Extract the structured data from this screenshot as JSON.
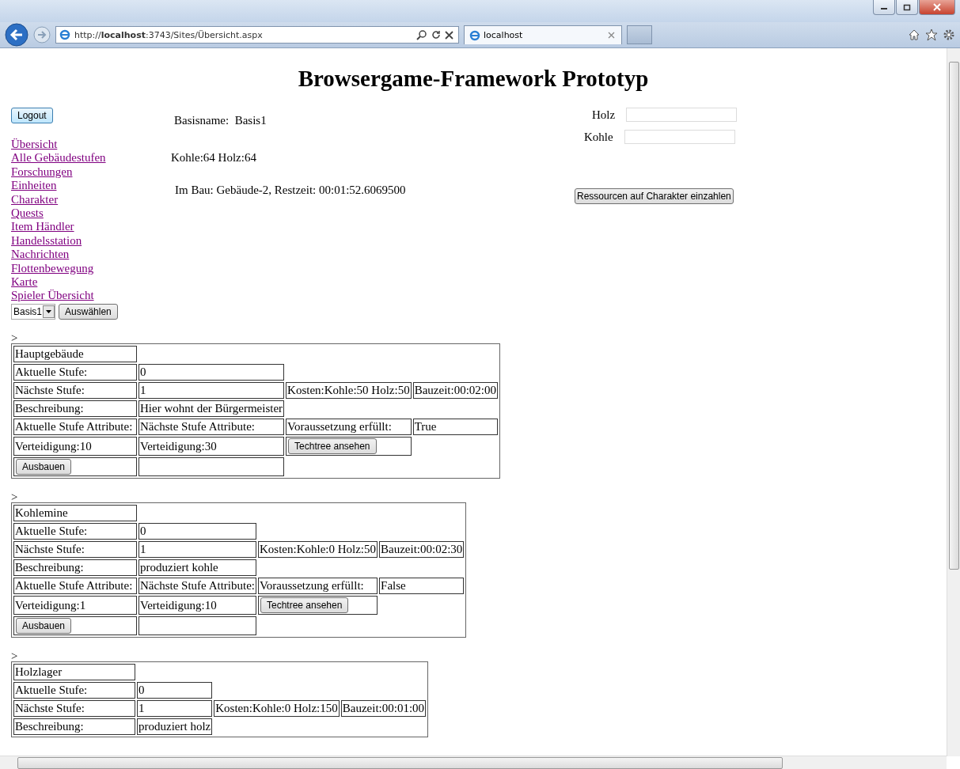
{
  "browser": {
    "address": "http://**localhost**:3743/Sites/Übersicht.aspx",
    "tab": "localhost"
  },
  "title": "Browsergame-Framework Prototyp",
  "logout": "Logout",
  "nav": [
    "Übersicht",
    "Alle Gebäudestufen",
    "Forschungen",
    "Einheiten",
    "Charakter",
    "Quests",
    "Item Händler",
    "Handelsstation",
    "Nachrichten",
    "Flottenbewegung",
    "Karte",
    "Spieler Übersicht"
  ],
  "base_select": {
    "value": "Basis1",
    "button": "Auswählen"
  },
  "info": [
    "Basisname:  Basis1",
    "Kohle:64 Holz:64",
    "Im Bau: Gebäude-2, Restzeit: 00:01:52.6069500"
  ],
  "deposit": {
    "fields": [
      {
        "label": "Holz"
      },
      {
        "label": "Kohle"
      }
    ],
    "button": "Ressourcen auf Charakter einzahlen"
  },
  "buildings": [
    {
      "marker": ">",
      "rows": [
        [
          {
            "kind": "text",
            "text": "Hauptgebäude"
          }
        ],
        [
          {
            "kind": "text",
            "text": "Aktuelle Stufe:"
          },
          {
            "kind": "text",
            "text": "0"
          }
        ],
        [
          {
            "kind": "text",
            "text": "Nächste Stufe:"
          },
          {
            "kind": "text",
            "text": "1"
          },
          {
            "kind": "text",
            "text": "Kosten:Kohle:50 Holz:50"
          },
          {
            "kind": "text",
            "text": "Bauzeit:00:02:00"
          }
        ],
        [
          {
            "kind": "text",
            "text": "Beschreibung:"
          },
          {
            "kind": "text",
            "text": "Hier wohnt der Bürgermeister"
          }
        ],
        [
          {
            "kind": "text",
            "text": "Aktuelle Stufe Attribute:"
          },
          {
            "kind": "text",
            "text": "Nächste Stufe Attribute:"
          },
          {
            "kind": "text",
            "text": "Voraussetzung erfüllt:"
          },
          {
            "kind": "text",
            "text": "True"
          }
        ],
        [
          {
            "kind": "text",
            "text": "Verteidigung:10"
          },
          {
            "kind": "text",
            "text": "Verteidigung:30"
          },
          {
            "kind": "button",
            "text": "Techtree ansehen"
          }
        ],
        [
          {
            "kind": "button",
            "text": "Ausbauen"
          },
          {
            "kind": "empty"
          }
        ]
      ]
    },
    {
      "marker": ">",
      "rows": [
        [
          {
            "kind": "text",
            "text": "Kohlemine"
          }
        ],
        [
          {
            "kind": "text",
            "text": "Aktuelle Stufe:"
          },
          {
            "kind": "text",
            "text": "0"
          }
        ],
        [
          {
            "kind": "text",
            "text": "Nächste Stufe:"
          },
          {
            "kind": "text",
            "text": "1"
          },
          {
            "kind": "text",
            "text": "Kosten:Kohle:0 Holz:50"
          },
          {
            "kind": "text",
            "text": "Bauzeit:00:02:30"
          }
        ],
        [
          {
            "kind": "text",
            "text": "Beschreibung:"
          },
          {
            "kind": "text",
            "text": "produziert kohle"
          }
        ],
        [
          {
            "kind": "text",
            "text": "Aktuelle Stufe Attribute:"
          },
          {
            "kind": "text",
            "text": "Nächste Stufe Attribute:"
          },
          {
            "kind": "text",
            "text": "Voraussetzung erfüllt:"
          },
          {
            "kind": "text",
            "text": "False"
          }
        ],
        [
          {
            "kind": "text",
            "text": "Verteidigung:1"
          },
          {
            "kind": "text",
            "text": "Verteidigung:10"
          },
          {
            "kind": "button",
            "text": "Techtree ansehen"
          }
        ],
        [
          {
            "kind": "button",
            "text": "Ausbauen"
          },
          {
            "kind": "empty"
          }
        ]
      ]
    },
    {
      "marker": ">",
      "rows": [
        [
          {
            "kind": "text",
            "text": "Holzlager"
          }
        ],
        [
          {
            "kind": "text",
            "text": "Aktuelle Stufe:"
          },
          {
            "kind": "text",
            "text": "0"
          }
        ],
        [
          {
            "kind": "text",
            "text": "Nächste Stufe:"
          },
          {
            "kind": "text",
            "text": "1"
          },
          {
            "kind": "text",
            "text": "Kosten:Kohle:0 Holz:150"
          },
          {
            "kind": "text",
            "text": "Bauzeit:00:01:00"
          }
        ],
        [
          {
            "kind": "text",
            "text": "Beschreibung:"
          },
          {
            "kind": "text",
            "text": "produziert holz"
          }
        ]
      ]
    }
  ]
}
